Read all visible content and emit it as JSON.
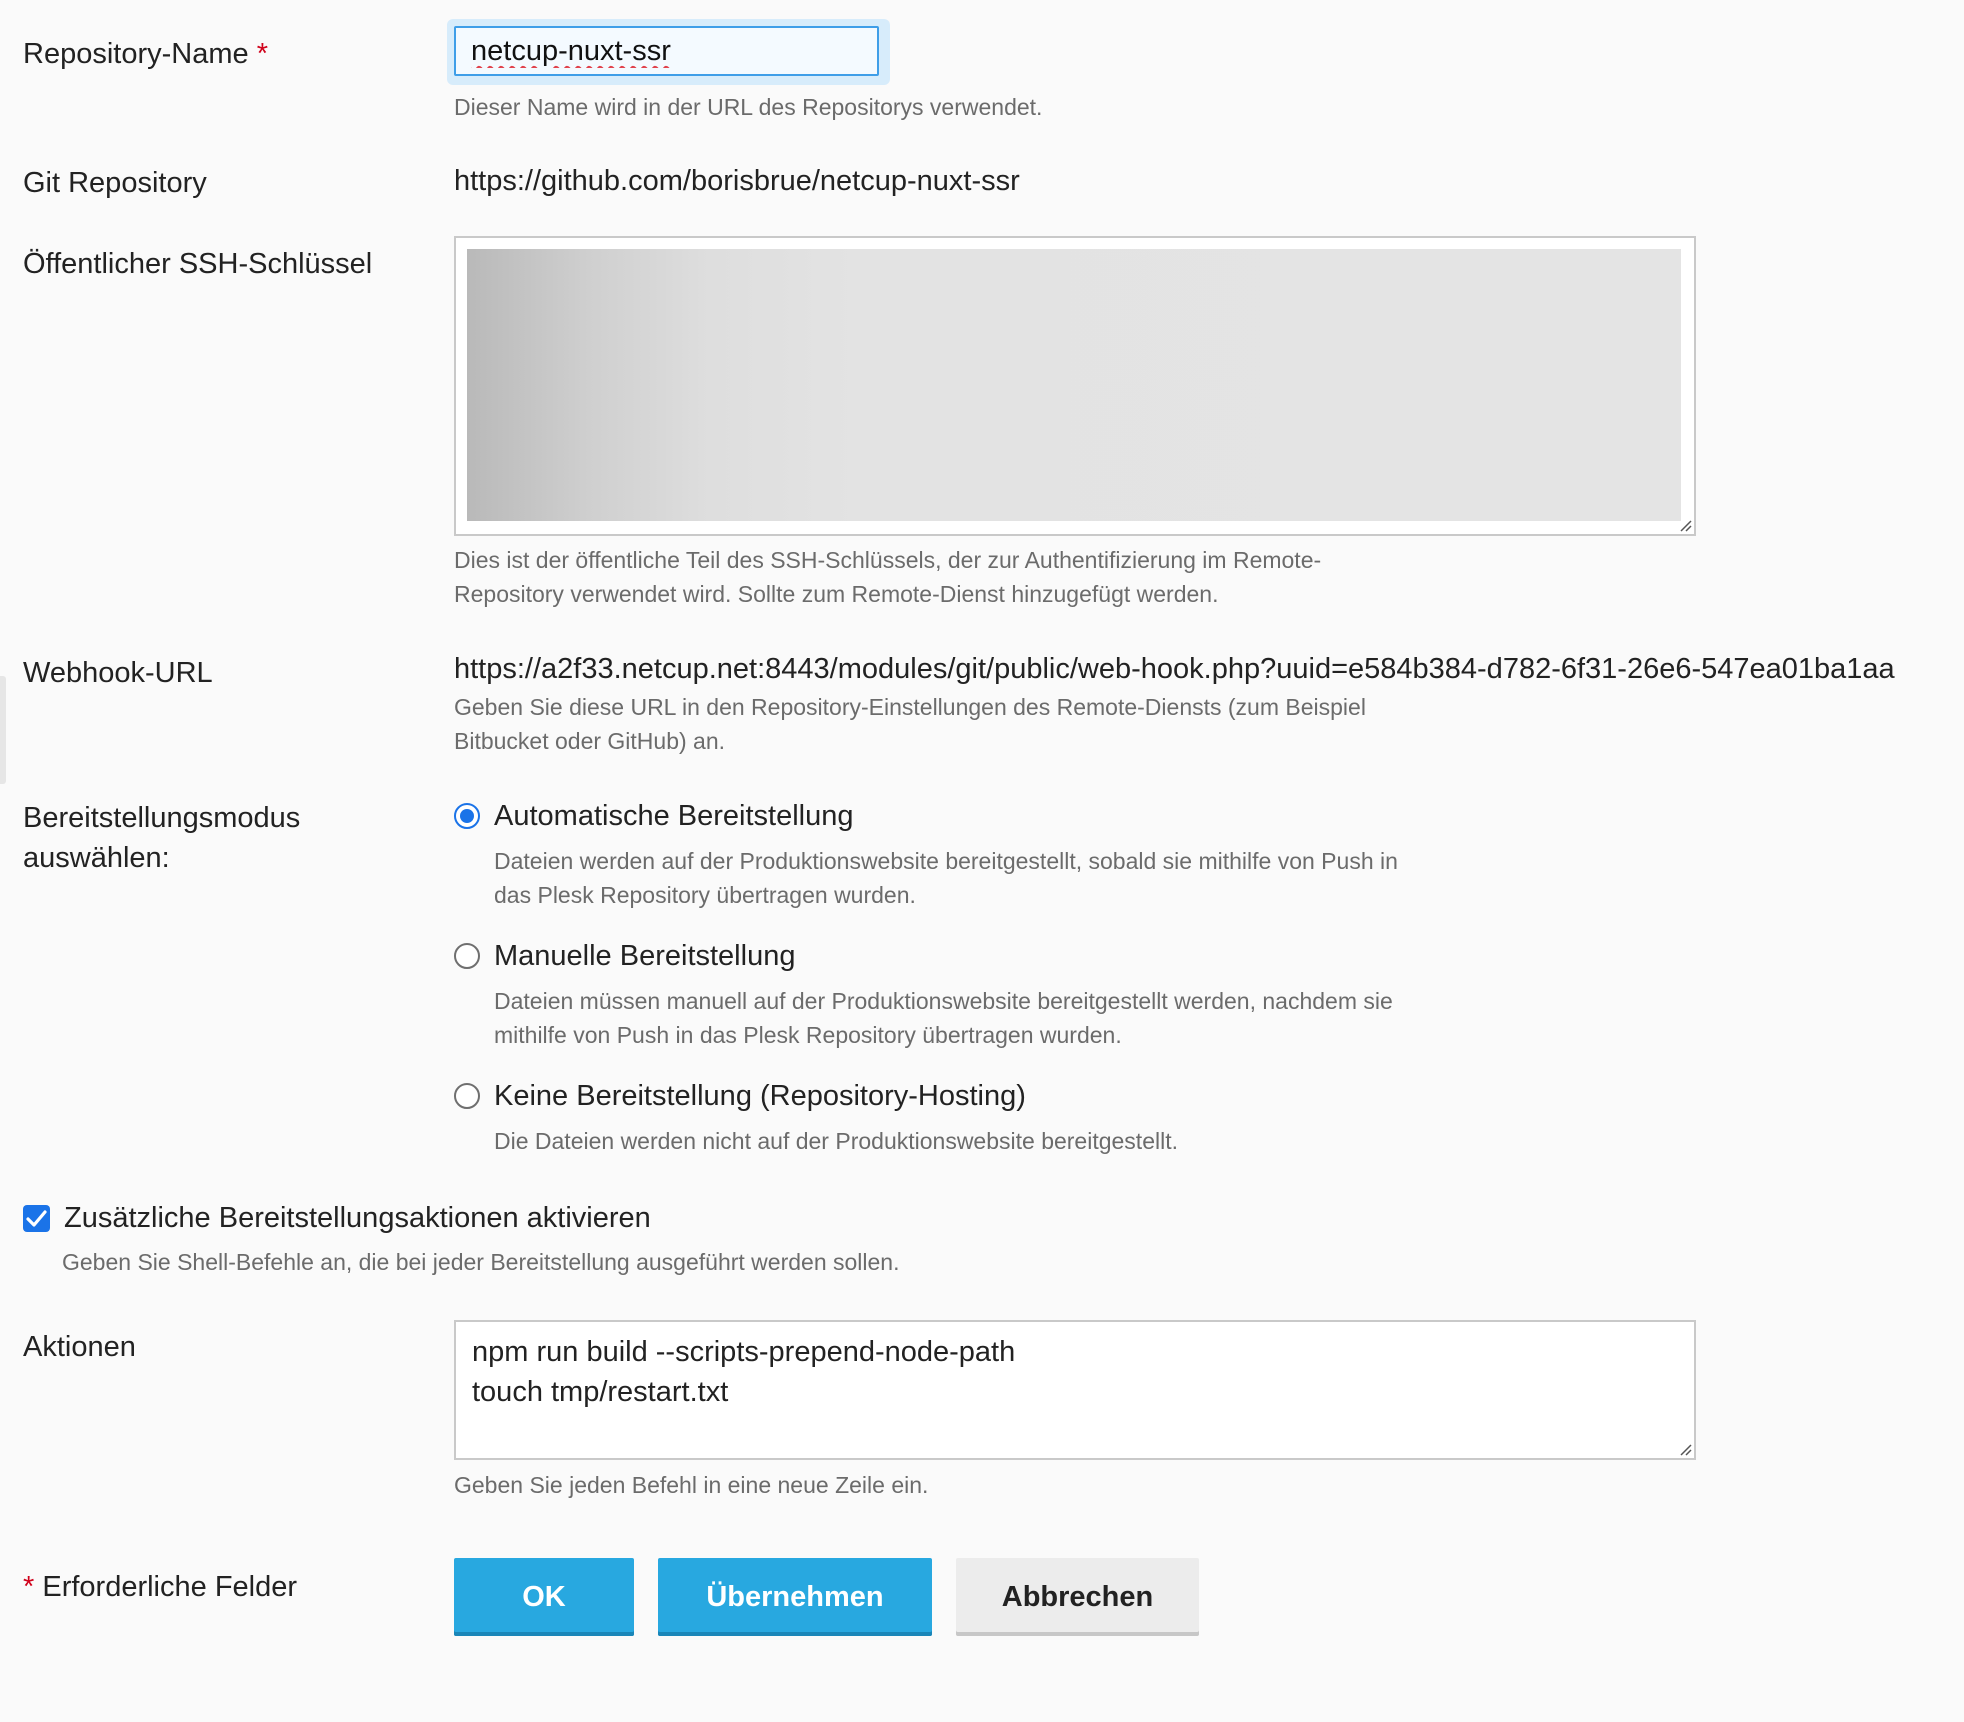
{
  "repo_name": {
    "label": "Repository-Name",
    "required_mark": "*",
    "value": "netcup-nuxt-ssr",
    "hint": "Dieser Name wird in der URL des Repositorys verwendet."
  },
  "git_repo": {
    "label": "Git Repository",
    "value": "https://github.com/borisbrue/netcup-nuxt-ssr"
  },
  "ssh_key": {
    "label": "Öffentlicher SSH-Schlüssel",
    "hint_line1": "Dies ist der öffentliche Teil des SSH-Schlüssels, der zur Authentifizierung im Remote-",
    "hint_line2": "Repository verwendet wird. Sollte zum Remote-Dienst hinzugefügt werden."
  },
  "webhook": {
    "label": "Webhook-URL",
    "value": "https://a2f33.netcup.net:8443/modules/git/public/web-hook.php?uuid=e584b384-d782-6f31-26e6-547ea01ba1aa",
    "hint_line1": "Geben Sie diese URL in den Repository-Einstellungen des Remote-Diensts (zum Beispiel",
    "hint_line2": "Bitbucket oder GitHub) an."
  },
  "deploy_mode": {
    "label_line1": "Bereitstellungsmodus",
    "label_line2": "auswählen:",
    "options": [
      {
        "label": "Automatische Bereitstellung",
        "desc_line1": "Dateien werden auf der Produktionswebsite bereitgestellt, sobald sie mithilfe von Push in",
        "desc_line2": "das Plesk Repository übertragen wurden.",
        "selected": true
      },
      {
        "label": "Manuelle Bereitstellung",
        "desc_line1": "Dateien müssen manuell auf der Produktionswebsite bereitgestellt werden, nachdem sie",
        "desc_line2": "mithilfe von Push in das Plesk Repository übertragen wurden.",
        "selected": false
      },
      {
        "label": "Keine Bereitstellung (Repository-Hosting)",
        "desc_line1": "Die Dateien werden nicht auf der Produktionswebsite bereitgestellt.",
        "selected": false
      }
    ]
  },
  "additional_actions": {
    "checkbox_label": "Zusätzliche Bereitstellungsaktionen aktivieren",
    "checked": true,
    "hint": "Geben Sie Shell-Befehle an, die bei jeder Bereitstellung ausgeführt werden sollen."
  },
  "actions": {
    "label": "Aktionen",
    "lines": [
      "npm run build --scripts-prepend-node-path",
      "touch tmp/restart.txt"
    ],
    "hint": "Geben Sie jeden Befehl in eine neue Zeile ein."
  },
  "footer": {
    "required_mark": "*",
    "required_text": "Erforderliche Felder",
    "ok_label": "OK",
    "apply_label": "Übernehmen",
    "cancel_label": "Abbrechen"
  },
  "colors": {
    "accent": "#1a73e8",
    "primary_button": "#28a8e0",
    "required": "#d0021b"
  }
}
